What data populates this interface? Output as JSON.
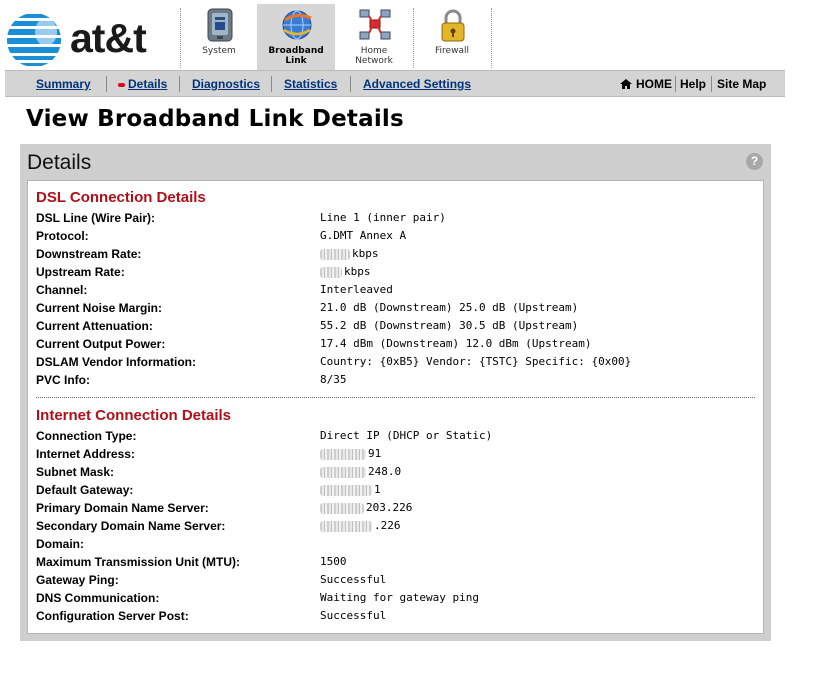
{
  "brand": {
    "logo_text": "at&t"
  },
  "nav_tabs": [
    {
      "label_line1": "System",
      "label_line2": "",
      "icon": "system-icon",
      "active": false
    },
    {
      "label_line1": "Broadband",
      "label_line2": "Link",
      "icon": "broadband-globe-icon",
      "active": true
    },
    {
      "label_line1": "Home",
      "label_line2": "Network",
      "icon": "home-network-icon",
      "active": false
    },
    {
      "label_line1": "Firewall",
      "label_line2": "",
      "icon": "padlock-icon",
      "active": false
    }
  ],
  "subnav": {
    "links": [
      "Summary",
      "Details",
      "Diagnostics",
      "Statistics",
      "Advanced Settings"
    ],
    "active": "Details",
    "right": {
      "home": "HOME",
      "help": "Help",
      "sitemap": "Site Map"
    }
  },
  "page_title": "View Broadband Link Details",
  "panel": {
    "title": "Details",
    "help_label": "?",
    "dsl": {
      "title": "DSL Connection Details",
      "rows": [
        {
          "label": "DSL Line (Wire Pair):",
          "value": "Line 1 (inner pair)"
        },
        {
          "label": "Protocol:",
          "value": "G.DMT Annex A"
        },
        {
          "label": "Downstream Rate:",
          "value": "kbps"
        },
        {
          "label": "Upstream Rate:",
          "value": "kbps"
        },
        {
          "label": "Channel:",
          "value": "Interleaved"
        },
        {
          "label": "Current Noise Margin:",
          "value": "21.0 dB (Downstream) 25.0 dB (Upstream)"
        },
        {
          "label": "Current Attenuation:",
          "value": "55.2 dB (Downstream) 30.5 dB (Upstream)"
        },
        {
          "label": "Current Output Power:",
          "value": "17.4 dBm (Downstream) 12.0 dBm (Upstream)"
        },
        {
          "label": "DSLAM Vendor Information:",
          "value": "Country: {0xB5} Vendor: {TSTC} Specific: {0x00}"
        },
        {
          "label": "PVC Info:",
          "value": "8/35"
        }
      ]
    },
    "internet": {
      "title": "Internet Connection Details",
      "rows": [
        {
          "label": "Connection Type:",
          "value": "Direct IP (DHCP or Static)"
        },
        {
          "label": "Internet Address:",
          "value": "91"
        },
        {
          "label": "Subnet Mask:",
          "value": "248.0"
        },
        {
          "label": "Default Gateway:",
          "value": "1"
        },
        {
          "label": "Primary Domain Name Server:",
          "value": "203.226"
        },
        {
          "label": "Secondary Domain Name Server:",
          "value": ".226"
        },
        {
          "label": "Domain:",
          "value": ""
        },
        {
          "label": "Maximum Transmission Unit (MTU):",
          "value": "1500"
        },
        {
          "label": "Gateway Ping:",
          "value": "Successful"
        },
        {
          "label": "DNS Communication:",
          "value": "Waiting for gateway ping"
        },
        {
          "label": "Configuration Server Post:",
          "value": "Successful"
        }
      ]
    }
  },
  "colors": {
    "link": "#00337a",
    "section_title": "#b0101a",
    "panel_bg": "#cfcfcf",
    "active_tab": "#d6d6d6"
  }
}
